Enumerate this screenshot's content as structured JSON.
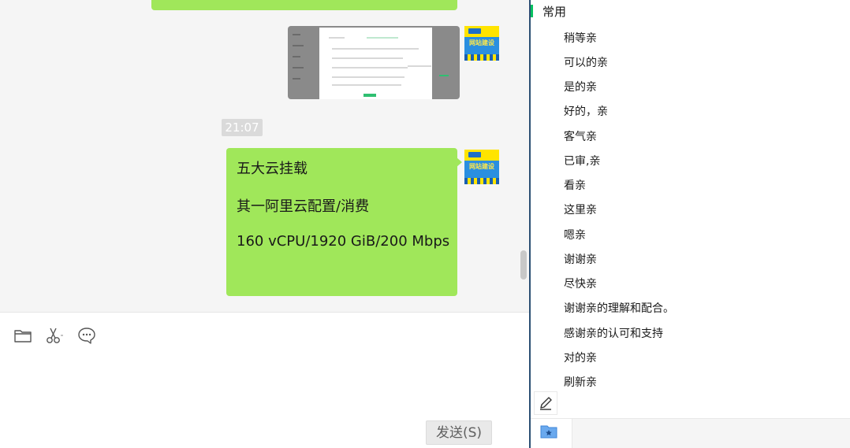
{
  "chat": {
    "timestamp": "21:07",
    "message_lines": [
      "五大云挂载",
      "其一阿里云配置/消费",
      "160 vCPU/1920 GiB/200 Mbps"
    ],
    "avatar_text": "网站建设",
    "send_label": "发送(S)",
    "toolbar_icons": [
      "folder-icon",
      "scissors-icon",
      "chat-bubble-icon"
    ]
  },
  "quick_replies": {
    "group_label": "常用",
    "phrases": [
      "稍等亲",
      "可以的亲",
      "是的亲",
      "好的，亲",
      "客气亲",
      "已审,亲",
      "看亲",
      "这里亲",
      "嗯亲",
      "谢谢亲",
      "尽快亲",
      "谢谢亲的理解和配合。",
      "感谢亲的认可和支持",
      "对的亲",
      "刷新亲"
    ],
    "edit_icon": "pencil-icon",
    "footer_icon": "star-folder-icon"
  },
  "colors": {
    "bubble": "#a0e75a",
    "accent": "#07c160",
    "divider": "#2b4f73"
  }
}
